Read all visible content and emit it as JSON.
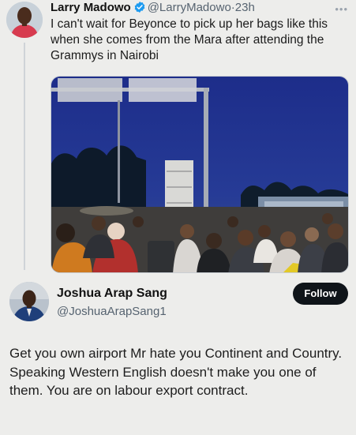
{
  "tweet": {
    "author_name": "Larry Madowo",
    "handle": "@LarryMadowo",
    "separator": "·",
    "time": "23h",
    "text": "I can't wait for Beyonce to pick up her bags like this when she comes from the Mara after attending the Grammys in Nairobi",
    "more_icon": "more-horizontal-icon",
    "verified_icon": "verified-badge-icon"
  },
  "reply": {
    "author_name": "Joshua Arap Sang",
    "handle": "@JoshuaArapSang1",
    "follow_label": "Follow",
    "text": "Get you own airport Mr hate you Continent and Country. Speaking Western English doesn't make you one of them. You are on labour export contract."
  },
  "colors": {
    "background": "#ededeb",
    "verified_blue": "#1d9bf0",
    "handle_gray": "#566370",
    "follow_bg": "#0f1419"
  }
}
